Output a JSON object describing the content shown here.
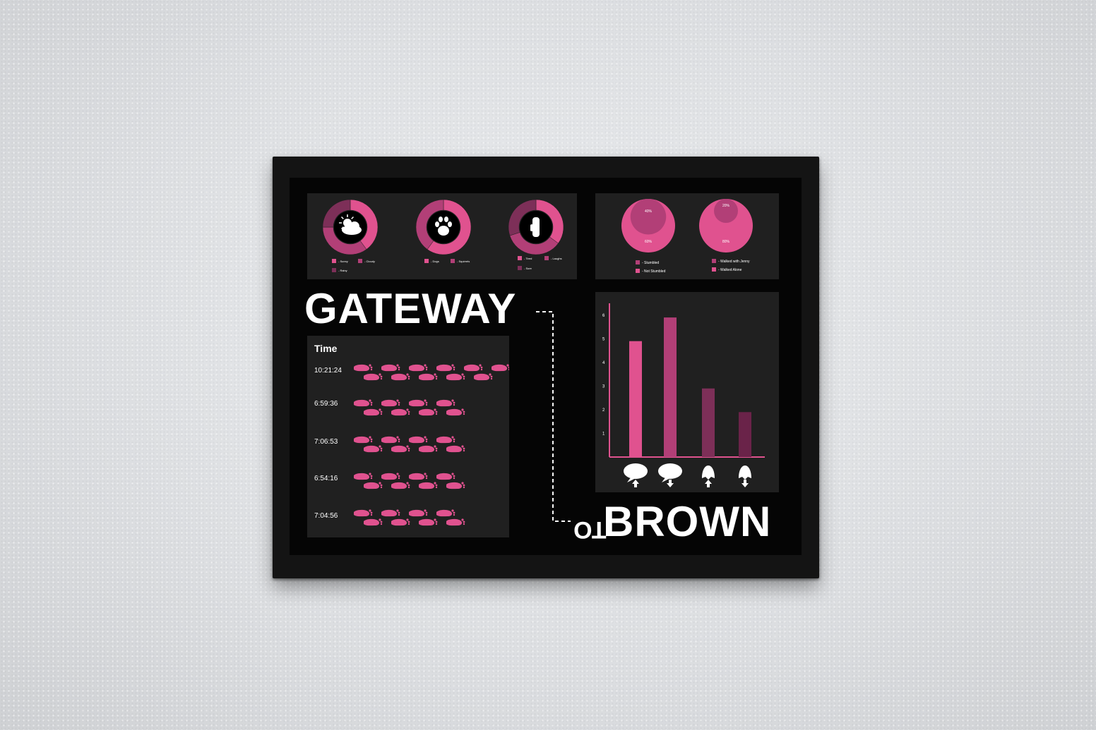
{
  "poster": {
    "title_word_1": "GATEWAY",
    "title_word_2": "TO",
    "title_word_3": "BROWN"
  },
  "colors": {
    "frame": "#141414",
    "poster_bg": "#050505",
    "panel_bg": "#202020",
    "pink": "#e0528f",
    "mid_pink": "#b23f77",
    "dark_pink": "#7d2f58",
    "darker_pink": "#6a2349",
    "text": "#ffffff"
  },
  "chart_data": [
    {
      "type": "pie",
      "variant": "donut",
      "center_icon": "cloud-sun-icon",
      "legend": [
        "- Sunny",
        "- Cloudy",
        "- Rainy"
      ],
      "values": [
        40,
        35,
        25
      ]
    },
    {
      "type": "pie",
      "variant": "donut",
      "center_icon": "paw-icon",
      "legend": [
        "- Dogs",
        "- Squirrels"
      ],
      "values": [
        60,
        40
      ]
    },
    {
      "type": "pie",
      "variant": "donut",
      "center_icon": "hand-icon",
      "legend": [
        "- Tired",
        "- Laughs",
        "- Sore"
      ],
      "values": [
        35,
        35,
        30
      ]
    },
    {
      "type": "pie",
      "variant": "nested-circle",
      "labels": [
        "40%",
        "60%"
      ],
      "values": [
        40,
        60
      ],
      "legend": [
        "- Stumbled",
        "- Not Stumbled"
      ]
    },
    {
      "type": "pie",
      "variant": "nested-circle",
      "labels": [
        "20%",
        "80%"
      ],
      "values": [
        20,
        80
      ],
      "legend": [
        "- Walked with Jenny",
        "- Walked Alone"
      ]
    },
    {
      "type": "table",
      "title": "Time",
      "rows": [
        {
          "time": "10:21:24",
          "footprints": 5.5
        },
        {
          "time": "6:59:36",
          "footprints": 4
        },
        {
          "time": "7:06:53",
          "footprints": 4
        },
        {
          "time": "6:54:16",
          "footprints": 4
        },
        {
          "time": "7:04:56",
          "footprints": 4
        }
      ]
    },
    {
      "type": "bar",
      "categories": [
        "speech-bubble-up-icon",
        "speech-bubble-down-icon",
        "snapchat-up-icon",
        "snapchat-down-icon"
      ],
      "values": [
        4.9,
        5.9,
        2.9,
        1.9
      ],
      "ylim": [
        0,
        6.5
      ],
      "yticks": [
        "1",
        "2",
        "3",
        "4",
        "5",
        "6"
      ],
      "colors": [
        "#e0528f",
        "#b23f77",
        "#7d2f58",
        "#6a2349"
      ]
    }
  ]
}
